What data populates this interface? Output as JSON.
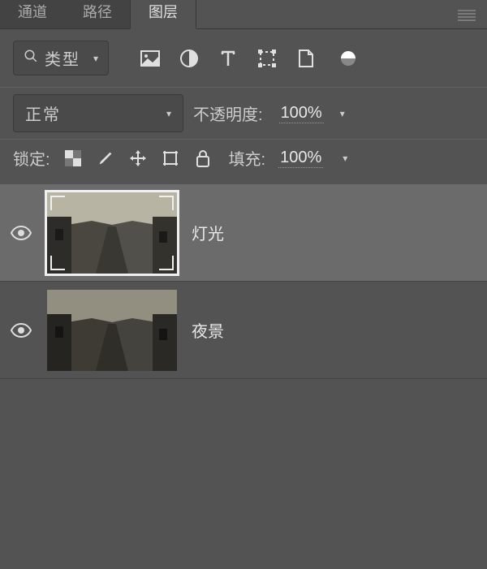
{
  "tabs": [
    {
      "label": "通道",
      "active": false
    },
    {
      "label": "路径",
      "active": false
    },
    {
      "label": "图层",
      "active": true
    }
  ],
  "filter": {
    "type_label": "类型"
  },
  "blend": {
    "mode": "正常",
    "opacity_label": "不透明度:",
    "opacity_value": "100%"
  },
  "lock": {
    "label": "锁定:",
    "fill_label": "填充:",
    "fill_value": "100%"
  },
  "layers": [
    {
      "name": "灯光",
      "selected": true,
      "visible": true
    },
    {
      "name": "夜景",
      "selected": false,
      "visible": true
    }
  ]
}
